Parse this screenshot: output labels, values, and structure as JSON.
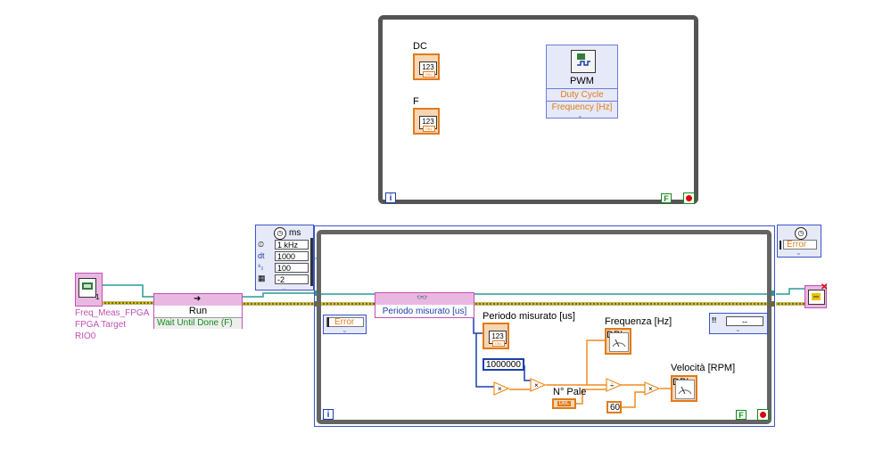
{
  "top_loop": {
    "dc_label": "DC",
    "f_label": "F",
    "dc_value": "123",
    "f_value": "123",
    "dc_tag": "DBL",
    "f_tag": "DBL",
    "pwm_title": "PWM",
    "pwm_inputs": [
      "Duty Cycle",
      "Frequency [Hz]"
    ],
    "iter_label": "i",
    "stop_label": "F"
  },
  "fpga_ref": {
    "lines": [
      "Freq_Meas_FPGA",
      "FPGA Target",
      "RIO0"
    ],
    "corner": "1"
  },
  "run_node": {
    "title": "Run",
    "option": "Wait Until Done (F)"
  },
  "timed_loop": {
    "unit": "ms",
    "config": [
      {
        "key": "kHz",
        "value": "1 kHz"
      },
      {
        "key": "dt",
        "value": "1000"
      },
      {
        "key": "priority",
        "value": "100"
      },
      {
        "key": "processor",
        "value": "-2"
      }
    ],
    "left_error": "Error",
    "right_error": "Error",
    "iter_label": "i",
    "stop_label": "F"
  },
  "read_node": {
    "item": "Periodo misurato [us]"
  },
  "main_loop": {
    "periodo_label": "Periodo misurato [us]",
    "periodo_value": "123",
    "periodo_tag": "DBL",
    "const_1000000": "1000000",
    "freq_label": "Frequenza [Hz]",
    "n_pale_label": "N° Pale",
    "n_pale_tag": "DBL",
    "const_60": "60",
    "speed_label": "Velocità [RPM]",
    "gauge_tag": "DBL",
    "right_output": "--",
    "right_marker": "!!"
  },
  "colors": {
    "numeric_wire": "#f08c1e",
    "refnum_wire": "#2a9a9a",
    "error_wire": "#7a6a00",
    "fpga_pink": "#c44fb5",
    "boolean_green": "#138a1a"
  }
}
